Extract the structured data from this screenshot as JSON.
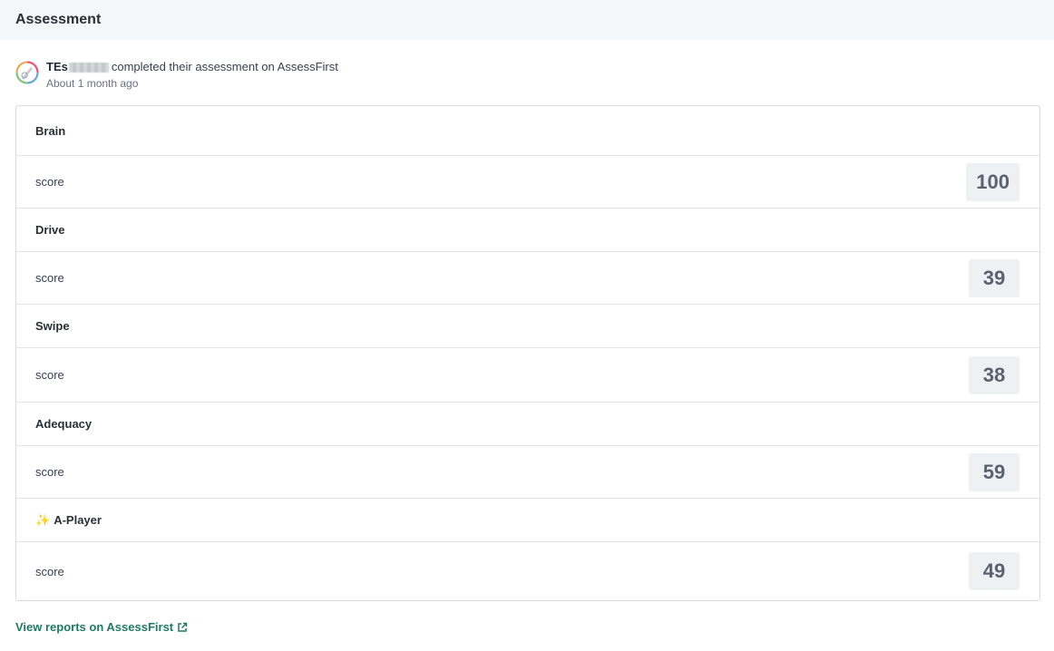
{
  "header": {
    "title": "Assessment"
  },
  "activity": {
    "user_name": "TEs",
    "message": "completed their assessment on AssessFirst",
    "time": "About 1 month ago"
  },
  "sections": [
    {
      "title": "Brain",
      "score_label": "score",
      "score": "100"
    },
    {
      "title": "Drive",
      "score_label": "score",
      "score": "39"
    },
    {
      "title": "Swipe",
      "score_label": "score",
      "score": "38"
    },
    {
      "title": "Adequacy",
      "score_label": "score",
      "score": "59"
    },
    {
      "title": "A-Player",
      "title_icon": "sparkles-icon",
      "score_label": "score",
      "score": "49"
    }
  ],
  "footer": {
    "link_label": "View reports on AssessFirst",
    "link_icon": "external-link-icon"
  },
  "colors": {
    "link": "#1f7a63",
    "badge_bg": "#eef0f3",
    "header_bg": "#f5f6f8"
  }
}
